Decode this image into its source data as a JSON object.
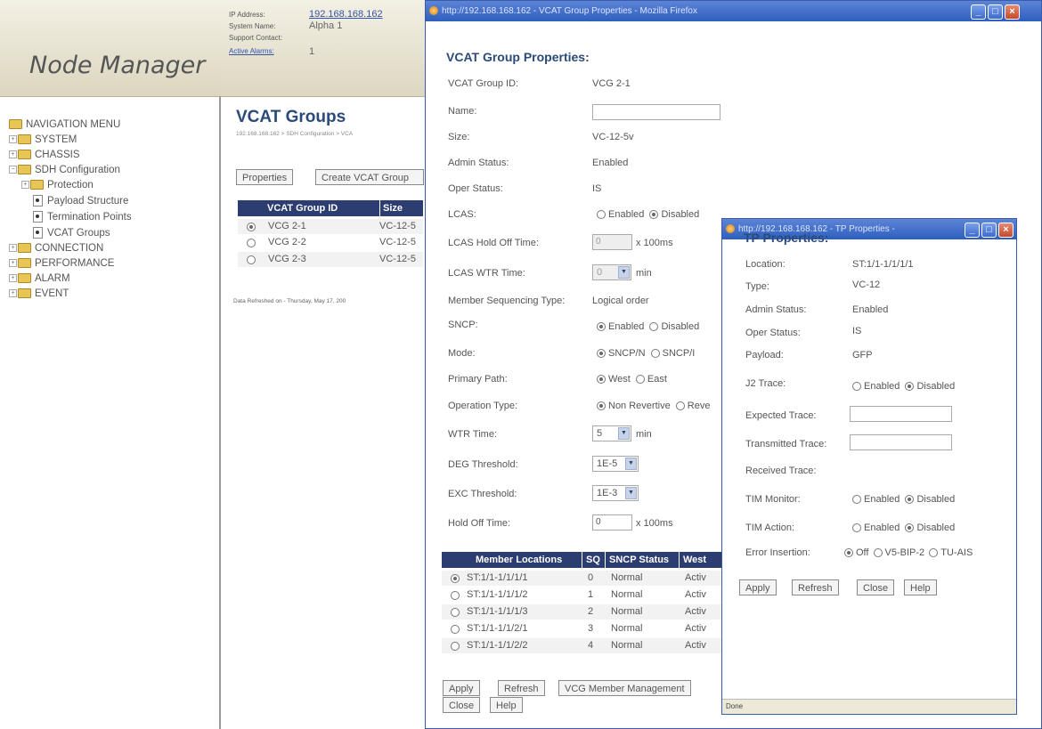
{
  "header": {
    "app_title": "Node Manager",
    "ip_label": "IP Address:",
    "ip_value": "192.168.168.162",
    "system_name_label": "System Name:",
    "system_name_value": "Alpha 1",
    "support_label": "Support Contact:",
    "alarms_label": "Active Alarms:",
    "alarms_value": "1"
  },
  "nav": {
    "root": "NAVIGATION MENU",
    "items": [
      "SYSTEM",
      "CHASSIS",
      "SDH Configuration",
      "Protection",
      "Payload Structure",
      "Termination Points",
      "VCAT Groups",
      "CONNECTION",
      "PERFORMANCE",
      "ALARM",
      "EVENT"
    ]
  },
  "main": {
    "title": "VCAT Groups",
    "breadcrumb": "192.168.168.162 > SDH Configuration > VCA",
    "btn_properties": "Properties",
    "btn_create": "Create VCAT Group",
    "columns": [
      "VCAT Group ID",
      "Size"
    ],
    "rows": [
      {
        "id": "VCG 2-1",
        "size": "VC-12-5"
      },
      {
        "id": "VCG 2-2",
        "size": "VC-12-5"
      },
      {
        "id": "VCG 2-3",
        "size": "VC-12-5"
      }
    ],
    "refreshed": "Data Refreshed on - Thursday, May 17, 200"
  },
  "vcat_window": {
    "title": "http://192.168.168.162 - VCAT Group Properties - Mozilla Firefox",
    "heading": "VCAT Group Properties:",
    "group_id_label": "VCAT Group ID:",
    "group_id_value": "VCG 2-1",
    "name_label": "Name:",
    "size_label": "Size:",
    "size_value": "VC-12-5v",
    "admin_label": "Admin Status:",
    "admin_value": "Enabled",
    "oper_label": "Oper Status:",
    "oper_value": "IS",
    "lcas_label": "LCAS:",
    "opt_enabled": "Enabled",
    "opt_disabled": "Disabled",
    "lcas_hold_label": "LCAS Hold Off Time:",
    "lcas_hold_value": "0",
    "unit_100ms": "x 100ms",
    "lcas_wtr_label": "LCAS WTR Time:",
    "lcas_wtr_value": "0",
    "unit_min": "min",
    "member_seq_label": "Member Sequencing Type:",
    "member_seq_value": "Logical order",
    "sncp_label": "SNCP:",
    "mode_label": "Mode:",
    "mode_opt1": "SNCP/N",
    "mode_opt2": "SNCP/I",
    "primary_label": "Primary Path:",
    "primary_opt1": "West",
    "primary_opt2": "East",
    "optype_label": "Operation Type:",
    "optype_opt1": "Non Revertive",
    "optype_opt2": "Reve",
    "wtr_label": "WTR Time:",
    "wtr_value": "5",
    "deg_label": "DEG Threshold:",
    "deg_value": "1E-5",
    "exc_label": "EXC Threshold:",
    "exc_value": "1E-3",
    "hold_label": "Hold Off Time:",
    "hold_value": "0",
    "member_columns": [
      "Member Locations",
      "SQ",
      "SNCP Status",
      "West"
    ],
    "members": [
      {
        "loc": "ST:1/1-1/1/1/1",
        "sq": "0",
        "status": "Normal",
        "west": "Activ"
      },
      {
        "loc": "ST:1/1-1/1/1/2",
        "sq": "1",
        "status": "Normal",
        "west": "Activ"
      },
      {
        "loc": "ST:1/1-1/1/1/3",
        "sq": "2",
        "status": "Normal",
        "west": "Activ"
      },
      {
        "loc": "ST:1/1-1/1/2/1",
        "sq": "3",
        "status": "Normal",
        "west": "Activ"
      },
      {
        "loc": "ST:1/1-1/1/2/2",
        "sq": "4",
        "status": "Normal",
        "west": "Activ"
      }
    ],
    "btn_apply": "Apply",
    "btn_refresh": "Refresh",
    "btn_vcg_member": "VCG Member Management",
    "btn_close": "Close",
    "btn_help": "Help"
  },
  "tp_window": {
    "title": "http://192.168.168.162 - TP Properties -",
    "heading": "TP Properties:",
    "location_label": "Location:",
    "location_value": "ST:1/1-1/1/1/1",
    "type_label": "Type:",
    "type_value": "VC-12",
    "admin_label": "Admin Status:",
    "admin_value": "Enabled",
    "oper_label": "Oper Status:",
    "oper_value": "IS",
    "payload_label": "Payload:",
    "payload_value": "GFP",
    "j2_label": "J2 Trace:",
    "opt_enabled": "Enabled",
    "opt_disabled": "Disabled",
    "expected_label": "Expected Trace:",
    "transmitted_label": "Transmitted Trace:",
    "received_label": "Received Trace:",
    "tim_monitor_label": "TIM Monitor:",
    "tim_action_label": "TIM Action:",
    "error_label": "Error Insertion:",
    "err_opt1": "Off",
    "err_opt2": "V5-BIP-2",
    "err_opt3": "TU-AIS",
    "btn_apply": "Apply",
    "btn_refresh": "Refresh",
    "btn_close": "Close",
    "btn_help": "Help",
    "status": "Done"
  }
}
